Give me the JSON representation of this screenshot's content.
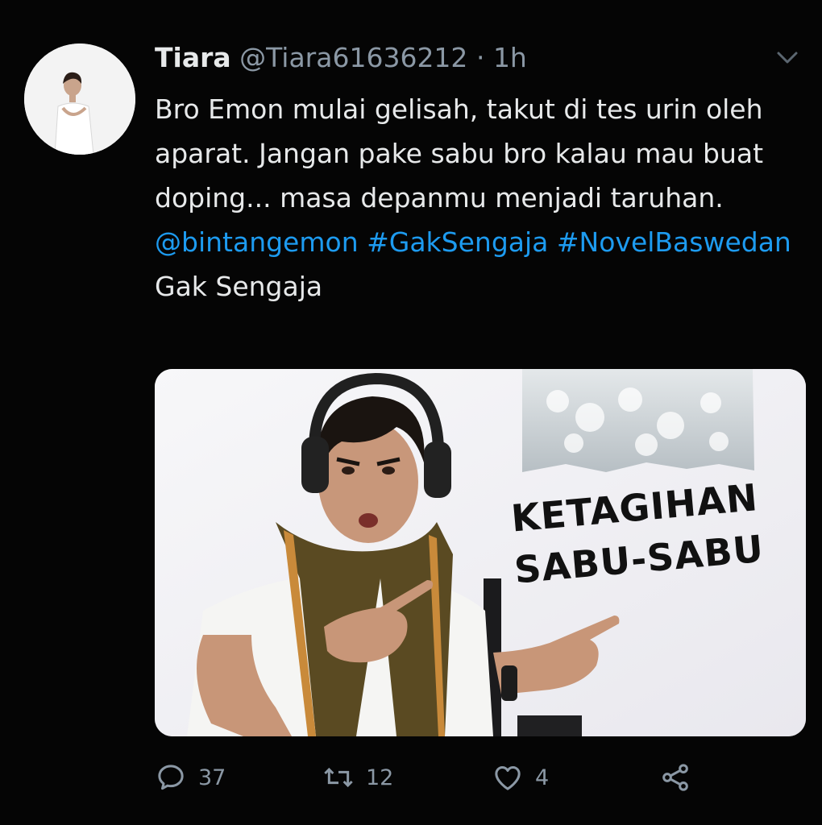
{
  "user": {
    "display_name": "Tiara",
    "handle": "@Tiara61636212",
    "separator": "·",
    "time": "1h"
  },
  "tweet": {
    "text_1": "Bro Emon mulai gelisah, takut di tes urin oleh aparat. Jangan pake sabu bro kalau mau buat doping... masa depanmu menjadi taruhan. ",
    "mention": "@bintangemon",
    "hashtag_1": "#GakSengaja",
    "hashtag_2": "#NovelBaswedan",
    "text_2": "Gak Sengaja"
  },
  "media": {
    "caption_line_1": "KETAGIHAN",
    "caption_line_2": "SABU-SABU"
  },
  "actions": {
    "reply_count": "37",
    "retweet_count": "12",
    "like_count": "4"
  },
  "colors": {
    "background": "#050505",
    "text": "#e7e9ea",
    "secondary": "#8b98a5",
    "link": "#1d9bf0"
  },
  "icons": [
    "chevron-down-icon",
    "reply-icon",
    "retweet-icon",
    "like-icon",
    "share-icon"
  ]
}
